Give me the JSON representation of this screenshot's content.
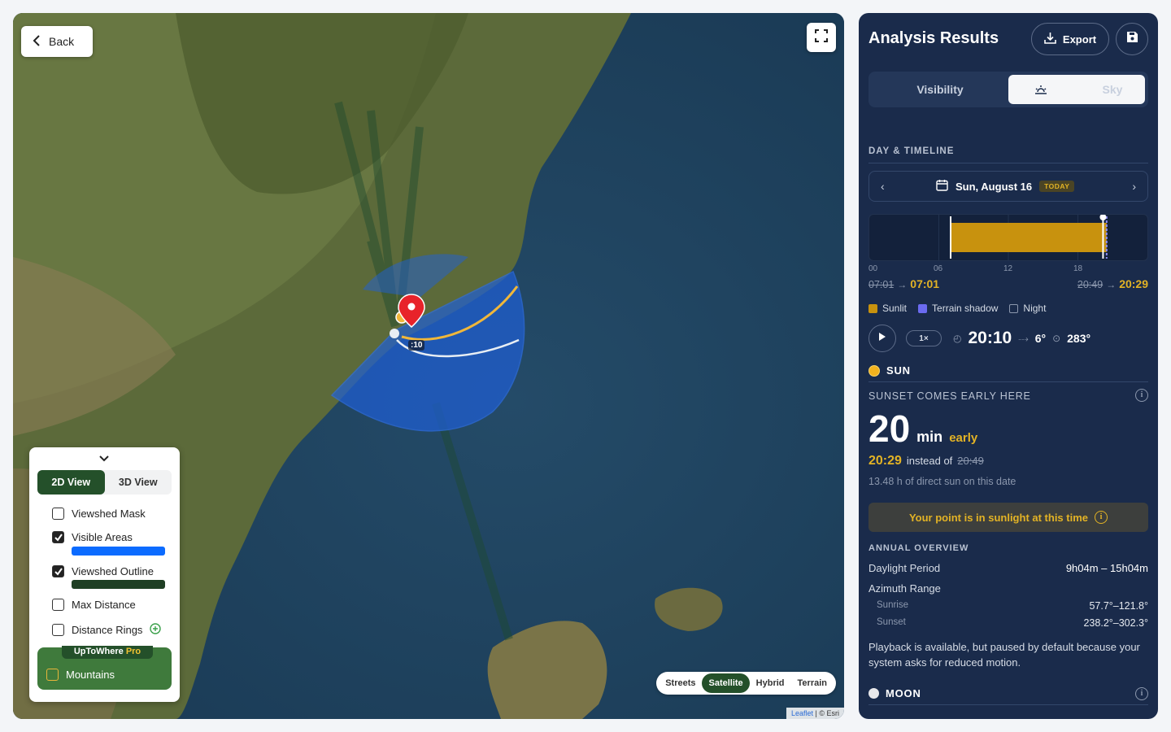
{
  "map": {
    "back_label": "Back",
    "time_tag": ":10",
    "basemaps": [
      "Streets",
      "Satellite",
      "Hybrid",
      "Terrain"
    ],
    "basemap_selected": "Satellite",
    "attribution_leaflet": "Leaflet",
    "attribution_rest": "| © Esri",
    "colors": {
      "viewshed": "#1f5fd6",
      "sun_path": "#f0b73a",
      "sun_path_alt": "#e8eef4",
      "pin": "#e8232a"
    }
  },
  "layers": {
    "view_2d": "2D View",
    "view_3d": "3D View",
    "view_selected": "2D View",
    "items": [
      {
        "label": "Viewshed Mask",
        "checked": false
      },
      {
        "label": "Visible Areas",
        "checked": true,
        "swatch": "#0b6bff"
      },
      {
        "label": "Viewshed Outline",
        "checked": true,
        "swatch": "#1f3f24"
      },
      {
        "label": "Max Distance",
        "checked": false
      },
      {
        "label": "Distance Rings",
        "checked": false
      }
    ],
    "pro_brand": "UpToWhere",
    "pro_tag": "Pro",
    "pro_item": {
      "label": "Mountains",
      "checked": false
    }
  },
  "panel": {
    "title": "Analysis Results",
    "export_label": "Export",
    "tabs": [
      "Visibility",
      "Sky"
    ],
    "tab_selected": "Sky",
    "section_day": "DAY & TIMELINE",
    "date_label": "Sun, August 16",
    "today_badge": "TODAY",
    "ticks": [
      "00",
      "06",
      "12",
      "18"
    ],
    "sunrise_old": "07:01",
    "sunrise_new": "07:01",
    "sunset_old": "20:49",
    "sunset_new": "20:29",
    "legend": {
      "sunlit": "Sunlit",
      "terrain": "Terrain shadow",
      "night": "Night"
    },
    "legend_colors": {
      "sunlit": "#c8920e",
      "terrain": "#6b6bf0",
      "night": "#1a2b4b"
    },
    "timeline": {
      "hours_total": 24,
      "sunlit_start": 7.02,
      "sunlit_end": 20.48,
      "cursor": 20.17
    },
    "speed": "1×",
    "current_time": "20:10",
    "altitude": "6°",
    "azimuth": "283°",
    "sun_label": "SUN",
    "sunset_header": "SUNSET COMES EARLY HERE",
    "early_minutes": "20",
    "early_unit": "min",
    "early_word": "early",
    "sunset_time": "20:29",
    "instead_of": "instead of",
    "sunset_expected": "20:49",
    "direct_sun": "13.48 h of direct sun on this date",
    "sunlight_status": "Your point is in sunlight at this time",
    "annual_header": "ANNUAL OVERVIEW",
    "daylight_label": "Daylight Period",
    "daylight_value": "9h04m – 15h04m",
    "azimuth_label": "Azimuth Range",
    "sunrise_label": "Sunrise",
    "sunrise_range": "57.7°–121.8°",
    "sunset_label": "Sunset",
    "sunset_range": "238.2°–302.3°",
    "playback_note": "Playback is available, but paused by default because your system asks for reduced motion.",
    "moon_label": "MOON"
  }
}
